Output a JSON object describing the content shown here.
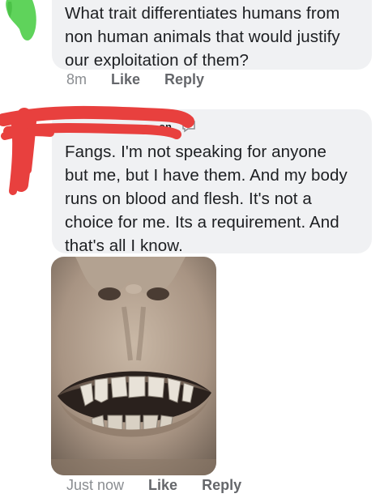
{
  "comment1": {
    "lines": [
      "What trait differentiates humans from",
      "non human animals that would justify",
      "our exploitation of them?"
    ],
    "time": "8m",
    "like": "Like",
    "reply": "Reply"
  },
  "comment2": {
    "name_fragment": "on",
    "lines": [
      "Fangs. I'm not speaking for anyone",
      "but me, but I have them. And my body",
      "runs on blood and flesh. It's not a",
      "choice for me. Its a requirement. And",
      "that's all I know."
    ],
    "time": "Just now",
    "like": "Like",
    "reply": "Reply",
    "photo_icon": "smiling-mouth-photo"
  },
  "redaction_colors": {
    "green": "#5fd35b",
    "red": "#e8403e"
  },
  "icons": {
    "avatar_badge": "chat-bubble-icon"
  }
}
